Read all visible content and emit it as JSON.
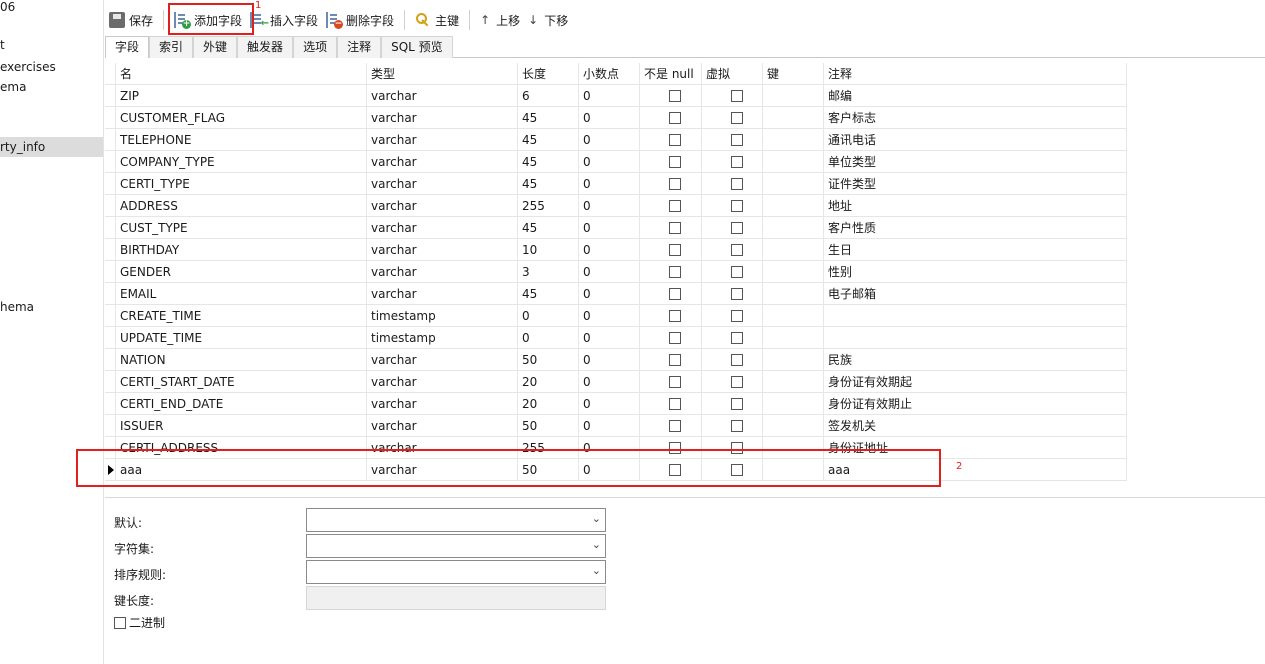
{
  "sidebar": {
    "items": [
      {
        "label": "06"
      },
      {
        "label": "t"
      },
      {
        "label": "exercises"
      },
      {
        "label": "ema"
      },
      {
        "label": "rty_info",
        "selected": true
      },
      {
        "label": "hema"
      }
    ]
  },
  "toolbar": {
    "save": "保存",
    "add_field": "添加字段",
    "insert_field": "插入字段",
    "delete_field": "删除字段",
    "primary_key": "主键",
    "move_up": "上移",
    "move_down": "下移"
  },
  "annotations": {
    "mark1": "1",
    "mark2": "2"
  },
  "tabs": [
    "字段",
    "索引",
    "外键",
    "触发器",
    "选项",
    "注释",
    "SQL 预览"
  ],
  "columns": {
    "name": "名",
    "type": "类型",
    "length": "长度",
    "decimals": "小数点",
    "not_null": "不是 null",
    "virtual": "虚拟",
    "key": "键",
    "comment": "注释"
  },
  "rows": [
    {
      "name": "ZIP",
      "type": "varchar",
      "length": "6",
      "decimals": "0",
      "not_null": false,
      "virtual": false,
      "comment": "邮编"
    },
    {
      "name": "CUSTOMER_FLAG",
      "type": "varchar",
      "length": "45",
      "decimals": "0",
      "not_null": false,
      "virtual": false,
      "comment": "客户标志"
    },
    {
      "name": "TELEPHONE",
      "type": "varchar",
      "length": "45",
      "decimals": "0",
      "not_null": false,
      "virtual": false,
      "comment": "通讯电话"
    },
    {
      "name": "COMPANY_TYPE",
      "type": "varchar",
      "length": "45",
      "decimals": "0",
      "not_null": false,
      "virtual": false,
      "comment": "单位类型"
    },
    {
      "name": "CERTI_TYPE",
      "type": "varchar",
      "length": "45",
      "decimals": "0",
      "not_null": false,
      "virtual": false,
      "comment": "证件类型"
    },
    {
      "name": "ADDRESS",
      "type": "varchar",
      "length": "255",
      "decimals": "0",
      "not_null": false,
      "virtual": false,
      "comment": "地址"
    },
    {
      "name": "CUST_TYPE",
      "type": "varchar",
      "length": "45",
      "decimals": "0",
      "not_null": false,
      "virtual": false,
      "comment": "客户性质"
    },
    {
      "name": "BIRTHDAY",
      "type": "varchar",
      "length": "10",
      "decimals": "0",
      "not_null": false,
      "virtual": false,
      "comment": "生日"
    },
    {
      "name": "GENDER",
      "type": "varchar",
      "length": "3",
      "decimals": "0",
      "not_null": false,
      "virtual": false,
      "comment": "性别"
    },
    {
      "name": "EMAIL",
      "type": "varchar",
      "length": "45",
      "decimals": "0",
      "not_null": false,
      "virtual": false,
      "comment": "电子邮箱"
    },
    {
      "name": "CREATE_TIME",
      "type": "timestamp",
      "length": "0",
      "decimals": "0",
      "not_null": false,
      "virtual": false,
      "comment": ""
    },
    {
      "name": "UPDATE_TIME",
      "type": "timestamp",
      "length": "0",
      "decimals": "0",
      "not_null": false,
      "virtual": false,
      "comment": ""
    },
    {
      "name": "NATION",
      "type": "varchar",
      "length": "50",
      "decimals": "0",
      "not_null": false,
      "virtual": false,
      "comment": "民族"
    },
    {
      "name": "CERTI_START_DATE",
      "type": "varchar",
      "length": "20",
      "decimals": "0",
      "not_null": false,
      "virtual": false,
      "comment": "身份证有效期起"
    },
    {
      "name": "CERTI_END_DATE",
      "type": "varchar",
      "length": "20",
      "decimals": "0",
      "not_null": false,
      "virtual": false,
      "comment": "身份证有效期止"
    },
    {
      "name": "ISSUER",
      "type": "varchar",
      "length": "50",
      "decimals": "0",
      "not_null": false,
      "virtual": false,
      "comment": "签发机关"
    },
    {
      "name": "CERTI_ADDRESS",
      "type": "varchar",
      "length": "255",
      "decimals": "0",
      "not_null": false,
      "virtual": false,
      "comment": "身份证地址"
    },
    {
      "name": "aaa",
      "type": "varchar",
      "length": "50",
      "decimals": "0",
      "not_null": false,
      "virtual": false,
      "comment": "aaa",
      "current": true
    }
  ],
  "properties": {
    "default_label": "默认:",
    "charset_label": "字符集:",
    "collation_label": "排序规则:",
    "key_length_label": "键长度:",
    "binary_label": "二进制",
    "default_value": "",
    "charset_value": "",
    "collation_value": ""
  },
  "colors": {
    "highlight": "#e0201c"
  }
}
